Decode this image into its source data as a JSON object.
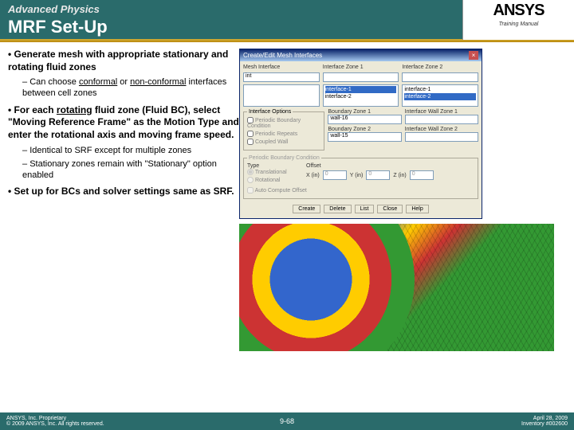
{
  "header": {
    "course": "Advanced Physics",
    "title": "MRF Set-Up",
    "logo": "ANSYS",
    "manual": "Training Manual"
  },
  "bullets": {
    "b1": "Generate mesh with appropriate stationary and rotating fluid zones",
    "b1s1_a": "Can choose ",
    "b1s1_b": "conformal",
    "b1s1_c": " or ",
    "b1s1_d": "non-conformal",
    "b1s1_e": " interfaces between cell zones",
    "b2_a": "For each ",
    "b2_b": "rotating",
    "b2_c": " fluid zone (Fluid BC), select \"Moving Reference Frame\" as the Motion Type and enter the rotational axis and moving frame speed.",
    "b2s1": "Identical to SRF except for multiple zones",
    "b2s2": "Stationary zones remain with \"Stationary\" option enabled",
    "b3": "Set up for BCs and solver settings same as SRF."
  },
  "dialog": {
    "title": "Create/Edit Mesh Interfaces",
    "mesh_interface_label": "Mesh Interface",
    "iz1_label": "Interface Zone 1",
    "iz2_label": "Interface Zone 2",
    "mi_value": "int",
    "iz1_list1": "interface-1",
    "iz1_list2": "interface-2",
    "iz2_list1": "interface-1",
    "iz2_list2": "interface-2",
    "opt_legend": "Interface Options",
    "opt1": "Periodic Boundary Condition",
    "opt2": "Periodic Repeats",
    "opt3": "Coupled Wall",
    "bz1_label": "Boundary Zone 1",
    "bz1_val": "wall-16",
    "bz2_label": "Boundary Zone 2",
    "bz2_val": "wall-15",
    "iwz1_label": "Interface Wall Zone 1",
    "iwz2_label": "Interface Wall Zone 2",
    "pbc_legend": "Periodic Boundary Condition",
    "type_label": "Type",
    "type1": "Translational",
    "type2": "Rotational",
    "offset_label": "Offset",
    "x": "X (in)",
    "y": "Y (in)",
    "z": "Z (in)",
    "xv": "0",
    "yv": "0",
    "zv": "0",
    "auto": "Auto Compute Offset",
    "btn_create": "Create",
    "btn_delete": "Delete",
    "btn_list": "List",
    "btn_close": "Close",
    "btn_help": "Help"
  },
  "footer": {
    "left1": "ANSYS, Inc. Proprietary",
    "left2": "© 2009 ANSYS, Inc. All rights reserved.",
    "center": "9-68",
    "right1": "April 28, 2009",
    "right2": "Inventory #002600"
  }
}
